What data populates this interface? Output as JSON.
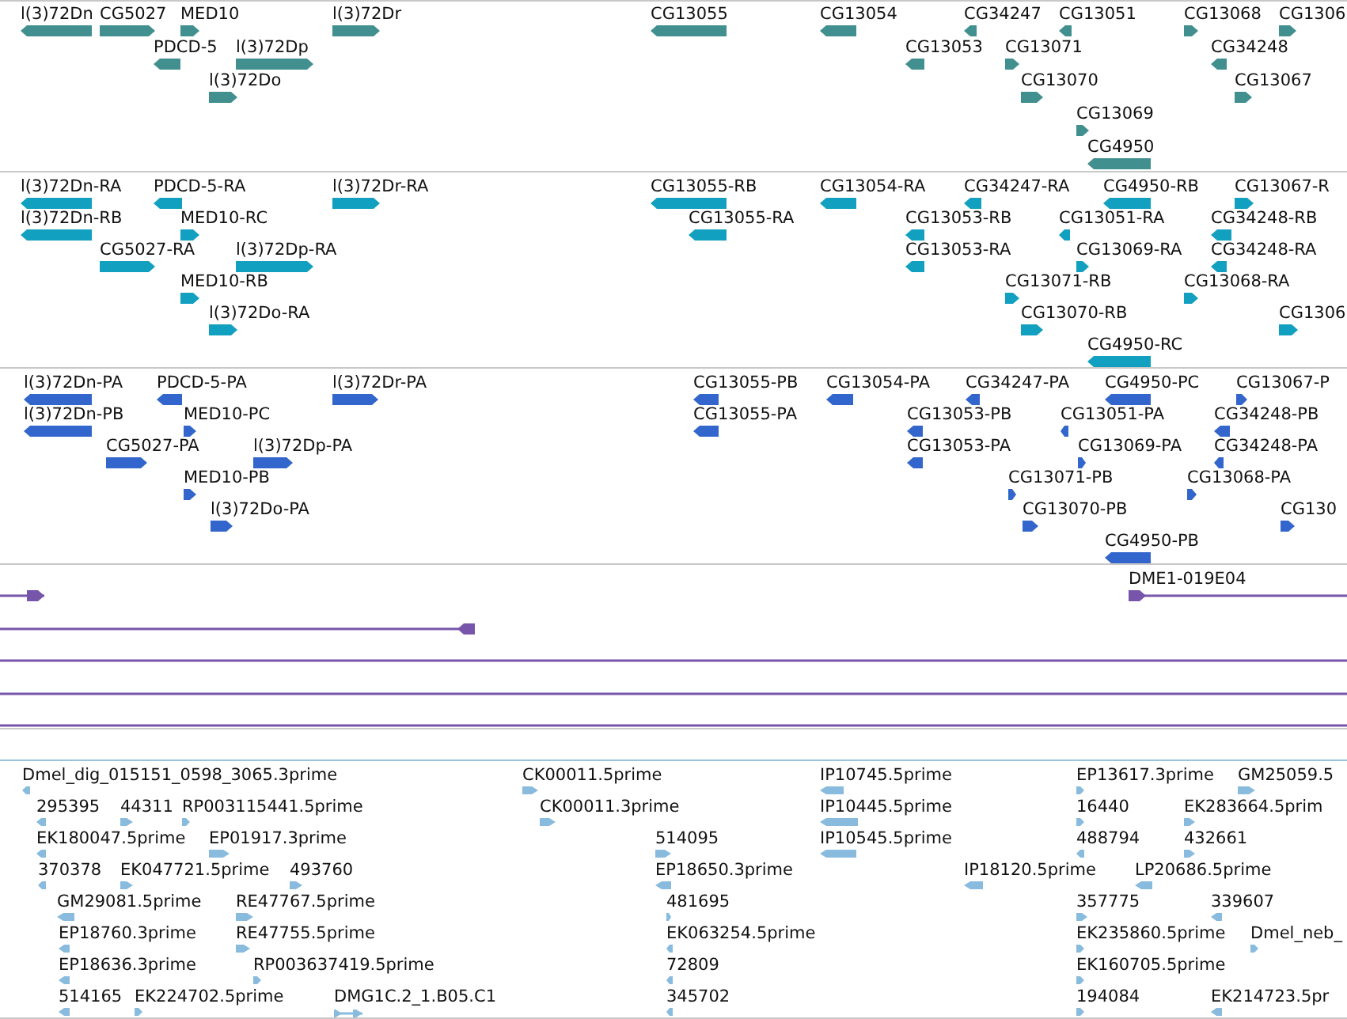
{
  "tracks": [
    {
      "color": "#418f8f",
      "features": [
        {
          "label": "l(3)72Dn",
          "reverse": true
        },
        {
          "label": "CG5027",
          "reverse": false
        },
        {
          "label": "MED10",
          "reverse": false
        },
        {
          "label": "l(3)72Dr",
          "reverse": false
        },
        {
          "label": "CG13055",
          "reverse": true
        },
        {
          "label": "CG13054",
          "reverse": true
        },
        {
          "label": "CG34247",
          "reverse": true
        },
        {
          "label": "CG13051",
          "reverse": true
        },
        {
          "label": "CG13068",
          "reverse": false
        },
        {
          "label": "CG1306",
          "reverse": false
        },
        {
          "label": "PDCD-5",
          "reverse": true
        },
        {
          "label": "l(3)72Dp",
          "reverse": false
        },
        {
          "label": "CG13053",
          "reverse": true
        },
        {
          "label": "CG13071",
          "reverse": false
        },
        {
          "label": "CG34248",
          "reverse": true
        },
        {
          "label": "l(3)72Do",
          "reverse": false
        },
        {
          "label": "CG13070",
          "reverse": false
        },
        {
          "label": "CG13067",
          "reverse": false
        },
        {
          "label": "CG13069",
          "reverse": false
        },
        {
          "label": "CG4950",
          "reverse": true
        }
      ]
    },
    {
      "color": "#12a0c0",
      "features": [
        {
          "label": "l(3)72Dn-RA",
          "reverse": true
        },
        {
          "label": "PDCD-5-RA",
          "reverse": true
        },
        {
          "label": "l(3)72Dr-RA",
          "reverse": false
        },
        {
          "label": "CG13055-RB",
          "reverse": true
        },
        {
          "label": "CG13054-RA",
          "reverse": true
        },
        {
          "label": "CG34247-RA",
          "reverse": true
        },
        {
          "label": "CG4950-RB",
          "reverse": true
        },
        {
          "label": "CG13067-R",
          "reverse": false
        },
        {
          "label": "l(3)72Dn-RB",
          "reverse": true
        },
        {
          "label": "MED10-RC",
          "reverse": false
        },
        {
          "label": "CG13055-RA",
          "reverse": true
        },
        {
          "label": "CG13053-RB",
          "reverse": true
        },
        {
          "label": "CG13051-RA",
          "reverse": true
        },
        {
          "label": "CG34248-RB",
          "reverse": true
        },
        {
          "label": "CG5027-RA",
          "reverse": false
        },
        {
          "label": "l(3)72Dp-RA",
          "reverse": false
        },
        {
          "label": "CG13053-RA",
          "reverse": true
        },
        {
          "label": "CG13069-RA",
          "reverse": false
        },
        {
          "label": "CG34248-RA",
          "reverse": true
        },
        {
          "label": "MED10-RB",
          "reverse": false
        },
        {
          "label": "CG13071-RB",
          "reverse": false
        },
        {
          "label": "CG13068-RA",
          "reverse": false
        },
        {
          "label": "l(3)72Do-RA",
          "reverse": false
        },
        {
          "label": "CG13070-RB",
          "reverse": false
        },
        {
          "label": "CG1306",
          "reverse": false
        },
        {
          "label": "CG4950-RC",
          "reverse": true
        }
      ]
    },
    {
      "color": "#3366cc",
      "features": [
        {
          "label": "l(3)72Dn-PA",
          "reverse": true
        },
        {
          "label": "PDCD-5-PA",
          "reverse": true
        },
        {
          "label": "l(3)72Dr-PA",
          "reverse": false
        },
        {
          "label": "CG13055-PB",
          "reverse": true
        },
        {
          "label": "CG13054-PA",
          "reverse": true
        },
        {
          "label": "CG34247-PA",
          "reverse": true
        },
        {
          "label": "CG4950-PC",
          "reverse": true
        },
        {
          "label": "CG13067-P",
          "reverse": false
        },
        {
          "label": "l(3)72Dn-PB",
          "reverse": true
        },
        {
          "label": "MED10-PC",
          "reverse": false
        },
        {
          "label": "CG13055-PA",
          "reverse": true
        },
        {
          "label": "CG13053-PB",
          "reverse": true
        },
        {
          "label": "CG13051-PA",
          "reverse": true
        },
        {
          "label": "CG34248-PB",
          "reverse": true
        },
        {
          "label": "CG5027-PA",
          "reverse": false
        },
        {
          "label": "l(3)72Dp-PA",
          "reverse": false
        },
        {
          "label": "CG13053-PA",
          "reverse": true
        },
        {
          "label": "CG13069-PA",
          "reverse": false
        },
        {
          "label": "CG34248-PA",
          "reverse": true
        },
        {
          "label": "MED10-PB",
          "reverse": false
        },
        {
          "label": "CG13071-PB",
          "reverse": false
        },
        {
          "label": "CG13068-PA",
          "reverse": false
        },
        {
          "label": "l(3)72Do-PA",
          "reverse": false
        },
        {
          "label": "CG13070-PB",
          "reverse": false
        },
        {
          "label": "CG130",
          "reverse": false
        },
        {
          "label": "CG4950-PB",
          "reverse": true
        }
      ]
    },
    {
      "color": "#7755aa",
      "features": [
        {
          "kind": "line",
          "reverse": false
        },
        {
          "kind": "line",
          "label": "DME1-019E04",
          "reverse": false
        },
        {
          "kind": "line",
          "reverse": true
        },
        {
          "kind": "line"
        },
        {
          "kind": "line"
        },
        {
          "kind": "line"
        }
      ]
    },
    {
      "color": "#88bbdd",
      "features": [
        {
          "label": "Dmel_dig_015151_0598_3065.3prime",
          "reverse": true
        },
        {
          "label": "CK00011.5prime",
          "reverse": false
        },
        {
          "label": "IP10745.5prime",
          "reverse": true
        },
        {
          "label": "EP13617.3prime",
          "reverse": false
        },
        {
          "label": "GM25059.5",
          "reverse": false
        },
        {
          "label": "295395",
          "reverse": true
        },
        {
          "label": "44311",
          "reverse": false
        },
        {
          "label": "RP003115441.5prime",
          "reverse": false
        },
        {
          "label": "CK00011.3prime",
          "reverse": false
        },
        {
          "label": "IP10445.5prime",
          "reverse": true
        },
        {
          "label": "16440",
          "reverse": false
        },
        {
          "label": "EK283664.5prim",
          "reverse": false
        },
        {
          "label": "EK180047.5prime",
          "reverse": true
        },
        {
          "label": "EP01917.3prime",
          "reverse": false
        },
        {
          "label": "514095",
          "reverse": false
        },
        {
          "label": "IP10545.5prime",
          "reverse": true
        },
        {
          "label": "488794",
          "reverse": true
        },
        {
          "label": "432661",
          "reverse": false
        },
        {
          "label": "370378",
          "reverse": true
        },
        {
          "label": "EK047721.5prime",
          "reverse": false
        },
        {
          "label": "493760",
          "reverse": false
        },
        {
          "label": "EP18650.3prime",
          "reverse": true
        },
        {
          "label": "IP18120.5prime",
          "reverse": true
        },
        {
          "label": "LP20686.5prime",
          "reverse": true
        },
        {
          "label": "GM29081.5prime",
          "reverse": true
        },
        {
          "label": "RE47767.5prime",
          "reverse": false
        },
        {
          "label": "481695",
          "reverse": false
        },
        {
          "label": "357775",
          "reverse": false
        },
        {
          "label": "339607",
          "reverse": true
        },
        {
          "label": "EP18760.3prime",
          "reverse": true
        },
        {
          "label": "RE47755.5prime",
          "reverse": false
        },
        {
          "label": "EK063254.5prime",
          "reverse": true
        },
        {
          "label": "EK235860.5prime",
          "reverse": false
        },
        {
          "label": "Dmel_neb_",
          "reverse": false
        },
        {
          "label": "EP18636.3prime",
          "reverse": true
        },
        {
          "label": "RP003637419.5prime",
          "reverse": false
        },
        {
          "label": "72809",
          "reverse": true
        },
        {
          "label": "EK160705.5prime",
          "reverse": false
        },
        {
          "label": "514165",
          "reverse": true
        },
        {
          "label": "EK224702.5prime",
          "reverse": false
        },
        {
          "label": "DMG1C.2_1.B05.C1",
          "kind": "line",
          "reverse": false
        },
        {
          "label": "345702",
          "reverse": true
        },
        {
          "label": "194084",
          "reverse": false
        },
        {
          "label": "EK214723.5pr",
          "reverse": true
        }
      ]
    }
  ]
}
